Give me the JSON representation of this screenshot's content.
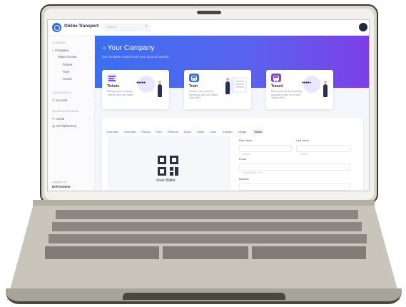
{
  "app": {
    "brand": "Online Transport",
    "search_placeholder": "Search",
    "icons": {
      "logo": "brand-circle-icon",
      "collapse": "chevron-left-icon",
      "search": "search-icon",
      "avatar": "user-avatar-icon"
    }
  },
  "sidebar": {
    "section_company": "COMPANY",
    "company": "Company",
    "team_access": "Team Access",
    "sub_items": [
      "Tickets",
      "Train",
      "Transit"
    ],
    "section_credentials": "CREDENTIALS",
    "account": "Account",
    "section_knowledge": "KNOWLEDGE BASE",
    "article": "Article",
    "api_reference": "API Reference",
    "footer_label": "Logged in as",
    "footer_user": "Drill Greens"
  },
  "hero": {
    "title": "Your Company",
    "subtitle": "Get complete control over your account activity"
  },
  "cards": [
    {
      "title": "Tickets",
      "desc": "Manage your company Tickets, all in one place!",
      "accent": "#7b4ff0",
      "icon": "list-icon"
    },
    {
      "title": "Train",
      "desc": "Locate Train routes & schedules with our Online Train APIs.",
      "accent": "#3a6ff0",
      "icon": "train-icon"
    },
    {
      "title": "Transit",
      "desc": "Build your own bus booking application with our Online Transit APIs.",
      "accent": "#8a3fe0",
      "icon": "bus-icon"
    }
  ],
  "tabs": [
    "Overview",
    "Generate",
    "Pricing",
    "Print",
    "Refunds",
    "Rules",
    "Sales",
    "Scan",
    "Transfer",
    "Usage",
    "Wallet"
  ],
  "active_tab": "Wallet",
  "wallet": {
    "scan_label": "Scan Wallet",
    "first_name_label": "First name",
    "first_name_placeholder": "Name",
    "last_name_label": "Last name",
    "last_name_placeholder": "Secret",
    "email_label": "Email",
    "email_placeholder": "name@site.com",
    "balance_label": "Balance"
  },
  "colors": {
    "primary": "#3a6ff0",
    "hero_end": "#7c3fe6",
    "text": "#2a2f45"
  }
}
